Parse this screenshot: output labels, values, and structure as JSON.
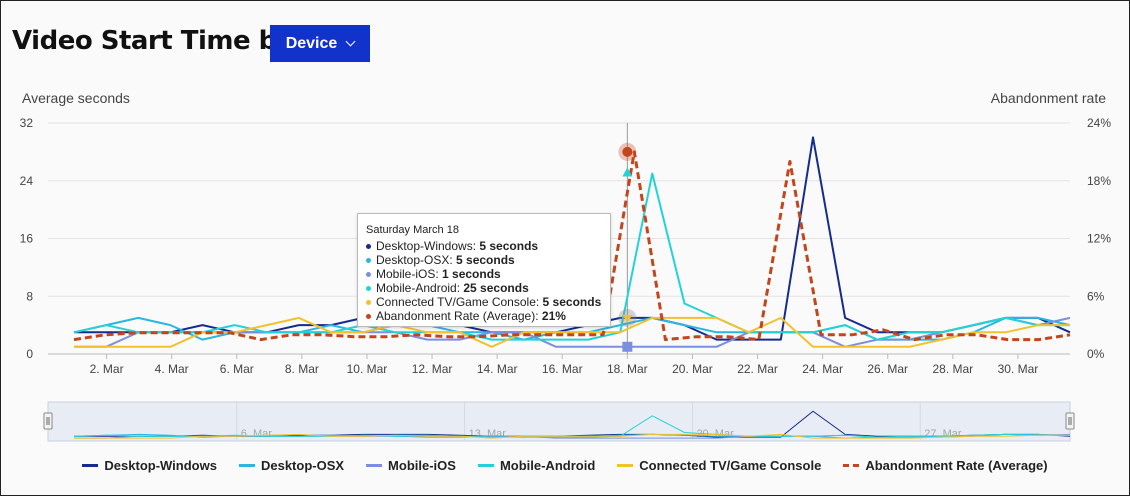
{
  "header": {
    "title": "Video Start Time by",
    "dropdown_label": "Device"
  },
  "chart_data": {
    "type": "line",
    "title": "Video Start Time by Device",
    "ylabel_left": "Average seconds",
    "ylabel_right": "Abandonment rate",
    "ylim_left": [
      0,
      32
    ],
    "ylim_right": [
      0,
      24
    ],
    "yticks_left": [
      "0",
      "8",
      "16",
      "24",
      "32"
    ],
    "yticks_right": [
      "0%",
      "6%",
      "12%",
      "18%",
      "24%"
    ],
    "x": [
      1,
      2,
      3,
      4,
      5,
      6,
      7,
      8,
      9,
      10,
      11,
      12,
      13,
      14,
      15,
      16,
      17,
      18,
      19,
      20,
      21,
      22,
      23,
      24,
      25,
      26,
      27,
      28,
      29,
      30,
      31
    ],
    "xticks": [
      "2. Mar",
      "4. Mar",
      "6. Mar",
      "8. Mar",
      "10. Mar",
      "12. Mar",
      "14. Mar",
      "16. Mar",
      "18. Mar",
      "20. Mar",
      "22. Mar",
      "24. Mar",
      "26. Mar",
      "28. Mar",
      "30. Mar"
    ],
    "xtick_values": [
      2,
      4,
      6,
      8,
      10,
      12,
      14,
      16,
      18,
      20,
      22,
      24,
      26,
      28,
      30
    ],
    "series": [
      {
        "name": "Desktop-Windows",
        "color": "#142b8f",
        "axis": "left",
        "dashed": false,
        "values": [
          3,
          3,
          3,
          3,
          4,
          3,
          3,
          4,
          4,
          5,
          5,
          5,
          4,
          3,
          3,
          3,
          4,
          5,
          5,
          4,
          2,
          2,
          2,
          30,
          5,
          3,
          3,
          3,
          4,
          5,
          5,
          3
        ]
      },
      {
        "name": "Desktop-OSX",
        "color": "#29b6e3",
        "axis": "left",
        "dashed": false,
        "values": [
          3,
          4,
          5,
          4,
          2,
          3,
          3,
          3,
          4,
          3,
          4,
          4,
          3,
          3,
          2,
          3,
          3,
          4,
          5,
          4,
          3,
          3,
          3,
          3,
          4,
          2,
          2,
          2,
          3,
          5,
          5,
          4
        ]
      },
      {
        "name": "Mobile-iOS",
        "color": "#7b8fe0",
        "axis": "left",
        "dashed": false,
        "values": [
          1,
          1,
          3,
          3,
          3,
          3,
          3,
          3,
          3,
          3,
          3,
          2,
          2,
          3,
          3,
          1,
          1,
          1,
          1,
          1,
          1,
          3,
          3,
          3,
          1,
          2,
          2,
          3,
          4,
          5,
          4,
          5
        ]
      },
      {
        "name": "Mobile-Android",
        "color": "#22d3d6",
        "axis": "left",
        "dashed": false,
        "values": [
          3,
          4,
          3,
          3,
          3,
          4,
          3,
          3,
          3,
          4,
          3,
          3,
          3,
          2,
          2,
          2,
          2,
          3,
          25,
          7,
          5,
          3,
          3,
          3,
          4,
          2,
          3,
          3,
          4,
          5,
          4,
          4
        ]
      },
      {
        "name": "Connected TV/Game Console",
        "color": "#f2c12e",
        "axis": "left",
        "dashed": false,
        "values": [
          1,
          1,
          1,
          1,
          3,
          3,
          4,
          5,
          3,
          3,
          4,
          3,
          3,
          1,
          3,
          3,
          3,
          3,
          5,
          5,
          5,
          3,
          5,
          1,
          1,
          1,
          1,
          2,
          3,
          3,
          4,
          4
        ]
      },
      {
        "name": "Abandonment Rate (Average)",
        "color": "#c4451c",
        "axis": "right",
        "dashed": true,
        "values": [
          1.5,
          2,
          2.2,
          2.2,
          2.2,
          2.2,
          1.5,
          2,
          2,
          1.8,
          1.8,
          2,
          1.8,
          1.8,
          2,
          2,
          2,
          2,
          21,
          1.5,
          1.8,
          1.8,
          1.5,
          20,
          2,
          2,
          2.5,
          1.5,
          2,
          2,
          1.5,
          1.5,
          2
        ]
      }
    ],
    "hover_index": 18,
    "tooltip": {
      "date": "Saturday March 18",
      "rows": [
        {
          "label": "Desktop-Windows",
          "value": "5 seconds",
          "color": "#142b8f"
        },
        {
          "label": "Desktop-OSX",
          "value": "5 seconds",
          "color": "#29b6e3"
        },
        {
          "label": "Mobile-iOS",
          "value": "1 seconds",
          "color": "#7b8fe0"
        },
        {
          "label": "Mobile-Android",
          "value": "25 seconds",
          "color": "#22d3d6"
        },
        {
          "label": "Connected TV/Game Console",
          "value": "5 seconds",
          "color": "#f2c12e"
        },
        {
          "label": "Abandonment Rate (Average)",
          "value": "21%",
          "color": "#c4451c"
        }
      ]
    },
    "navigator_ticks": [
      "6. Mar",
      "13. Mar",
      "20. Mar",
      "27. Mar"
    ],
    "navigator_tick_values": [
      6,
      13,
      20,
      27
    ],
    "grid": true,
    "legend_position": "bottom"
  }
}
